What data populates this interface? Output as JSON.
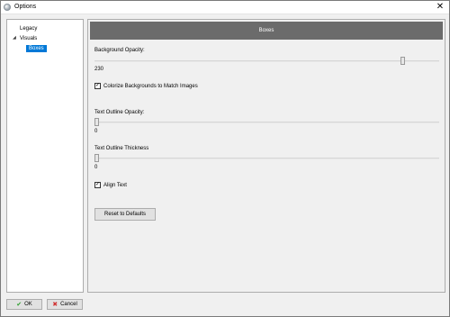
{
  "window": {
    "title": "Options",
    "close_glyph": "✕"
  },
  "sidebar": {
    "items": [
      {
        "label": "Legacy"
      },
      {
        "label": "Visuals",
        "expander": "◢"
      },
      {
        "label": "Boxes",
        "selected": true
      }
    ]
  },
  "panel": {
    "header": "Boxes",
    "background_opacity": {
      "label": "Background Opacity:",
      "value": "230",
      "fraction": 0.9
    },
    "colorize_checkbox": {
      "label": "Colorize Backgrounds to Match Images",
      "checked": true
    },
    "text_outline_opacity": {
      "label": "Text Outline Opacity:",
      "value": "0",
      "fraction": 0
    },
    "text_outline_thickness": {
      "label": "Text Outline Thickness",
      "value": "0",
      "fraction": 0
    },
    "align_checkbox": {
      "label": "Align Text",
      "checked": true
    },
    "reset_button": "Reset to Defaults"
  },
  "footer": {
    "ok_label": "OK",
    "cancel_label": "Cancel"
  },
  "colors": {
    "ok_icon": "#2e9e2e",
    "cancel_icon": "#d13232",
    "selection": "#0078d7",
    "header_bg": "#6b6b6b"
  },
  "icons": {
    "ok": "checkmark-icon",
    "cancel": "x-icon",
    "app": "app-icon"
  }
}
